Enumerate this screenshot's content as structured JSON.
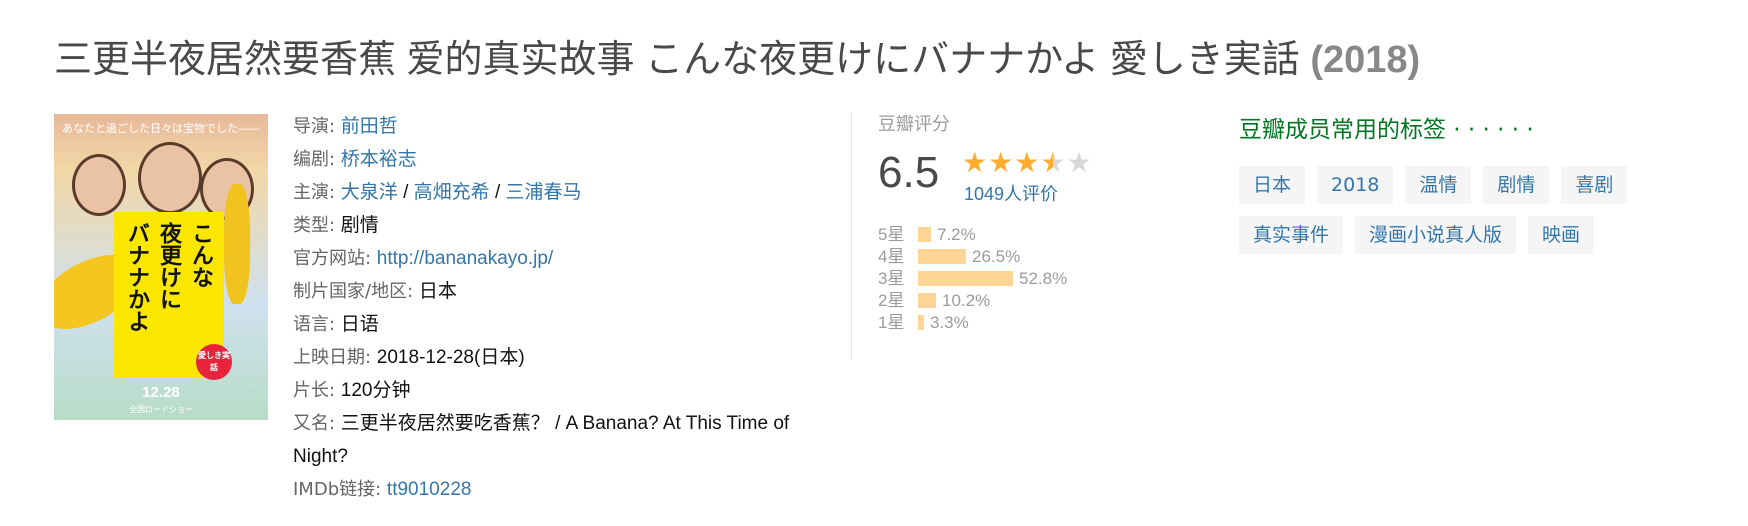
{
  "title": {
    "main": "三更半夜居然要香蕉 爱的真实故事 こんな夜更けにバナナかよ 愛しき実話",
    "year": "(2018)"
  },
  "poster": {
    "top_text": "あなたと過ごした日々は宝物でした——",
    "col1": "こんな",
    "col2": "夜更けに",
    "col3": "バナナかよ",
    "badge": "愛しき実話",
    "date": "12.28",
    "sub": "全国ロードショー"
  },
  "info": {
    "director_label": "导演",
    "director": "前田哲",
    "writer_label": "编剧",
    "writer": "桥本裕志",
    "cast_label": "主演",
    "cast": [
      "大泉洋",
      "高畑充希",
      "三浦春马"
    ],
    "separator": " / ",
    "genre_label": "类型",
    "genre": "剧情",
    "site_label": "官方网站",
    "site": "http://bananakayo.jp/",
    "country_label": "制片国家/地区",
    "country": "日本",
    "language_label": "语言",
    "language": "日语",
    "release_label": "上映日期",
    "release": "2018-12-28(日本)",
    "runtime_label": "片长",
    "runtime": "120分钟",
    "aka_label": "又名",
    "aka": "三更半夜居然要吃香蕉？ / A Banana? At This Time of Night?",
    "imdb_label": "IMDb链接",
    "imdb": "tt9010228"
  },
  "rating": {
    "label": "豆瓣评分",
    "score": "6.5",
    "stars_value": 3.5,
    "votes": "1049人评价",
    "distribution": [
      {
        "label": "5星",
        "percent": 7.2,
        "text": "7.2%"
      },
      {
        "label": "4星",
        "percent": 26.5,
        "text": "26.5%"
      },
      {
        "label": "3星",
        "percent": 52.8,
        "text": "52.8%"
      },
      {
        "label": "2星",
        "percent": 10.2,
        "text": "10.2%"
      },
      {
        "label": "1星",
        "percent": 3.3,
        "text": "3.3%"
      }
    ]
  },
  "tags": {
    "title": "豆瓣成员常用的标签 · · · · · ·",
    "items": [
      "日本",
      "2018",
      "温情",
      "剧情",
      "喜剧",
      "真实事件",
      "漫画小说真人版",
      "映画"
    ]
  },
  "colors": {
    "link": "#3377aa",
    "tag_title": "#007722",
    "star": "#ffac2d",
    "bar": "#ffd596"
  }
}
